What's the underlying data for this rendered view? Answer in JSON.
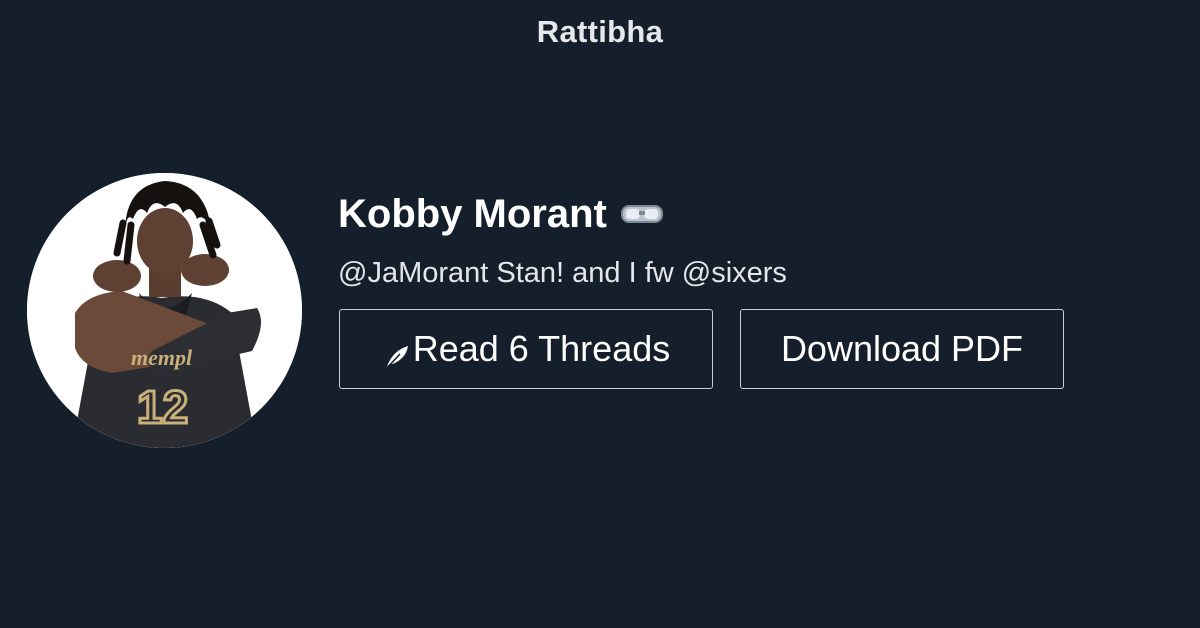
{
  "site": {
    "brand": "Rattibha"
  },
  "profile": {
    "name": "Kobby Morant",
    "name_emoji": "goggles-icon",
    "bio": "@JaMorant Stan! and I fw @sixers",
    "avatar_jersey_text": "mempl",
    "avatar_jersey_number": "12"
  },
  "actions": {
    "read_label": "Read 6 Threads",
    "read_icon": "feather-icon",
    "download_label": "Download PDF"
  },
  "colors": {
    "background": "#151f2b",
    "text": "#ffffff",
    "button_border": "#c9cdd3"
  }
}
